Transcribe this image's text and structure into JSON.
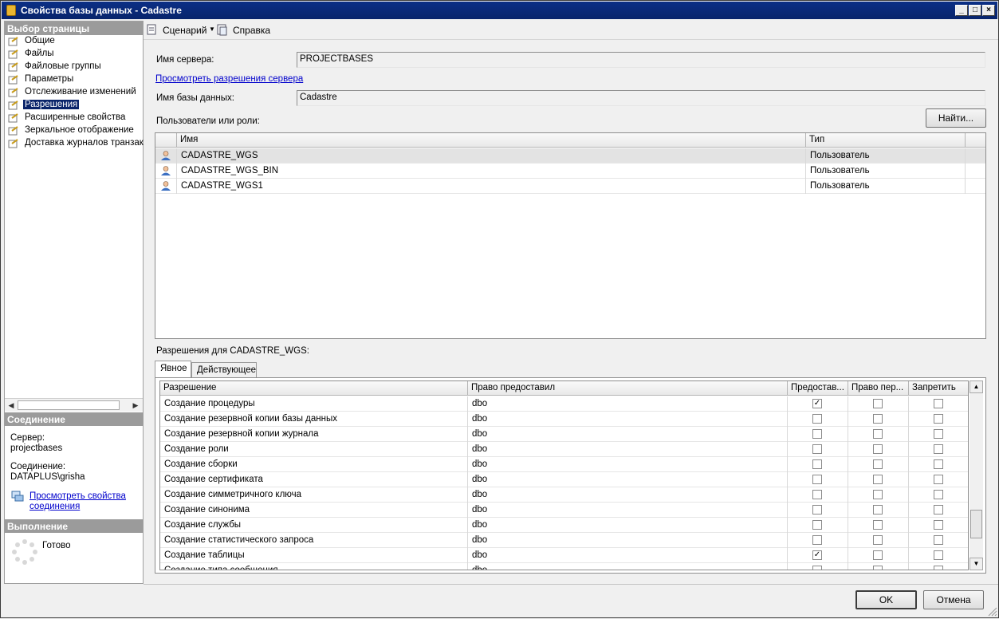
{
  "window": {
    "title": "Свойства базы данных - Cadastre"
  },
  "left_panel": {
    "select_page_header": "Выбор страницы",
    "items": [
      {
        "label": "Общие"
      },
      {
        "label": "Файлы"
      },
      {
        "label": "Файловые группы"
      },
      {
        "label": "Параметры"
      },
      {
        "label": "Отслеживание изменений"
      },
      {
        "label": "Разрешения",
        "selected": true
      },
      {
        "label": "Расширенные свойства"
      },
      {
        "label": "Зеркальное отображение"
      },
      {
        "label": "Доставка журналов транзакций"
      }
    ],
    "connection_header": "Соединение",
    "server_label": "Сервер:",
    "server_value": "projectbases",
    "connection_label": "Соединение:",
    "connection_value": "DATAPLUS\\grisha",
    "view_conn_link_1": "Просмотреть свойства",
    "view_conn_link_2": "соединения",
    "progress_header": "Выполнение",
    "progress_status": "Готово"
  },
  "toolbar": {
    "script_label": "Сценарий",
    "help_label": "Справка"
  },
  "main": {
    "server_name_label": "Имя сервера:",
    "server_name_value": "PROJECTBASES",
    "view_server_perms_link": "Просмотреть разрешения сервера",
    "db_name_label": "Имя базы данных:",
    "db_name_value": "Cadastre",
    "users_roles_label": "Пользователи или роли:",
    "find_button": "Найти...",
    "users_columns": {
      "name": "Имя",
      "type": "Тип"
    },
    "users": [
      {
        "name": "CADASTRE_WGS",
        "type": "Пользователь",
        "selected": true
      },
      {
        "name": "CADASTRE_WGS_BIN",
        "type": "Пользователь"
      },
      {
        "name": "CADASTRE_WGS1",
        "type": "Пользователь"
      }
    ],
    "perms_for_label": "Разрешения для CADASTRE_WGS:",
    "tabs": [
      {
        "label": "Явное",
        "active": true
      },
      {
        "label": "Действующее"
      }
    ],
    "perm_columns": {
      "permission": "Разрешение",
      "grantor": "Право предоставил",
      "grant": "Предостав...",
      "with_grant": "Право пер...",
      "deny": "Запретить"
    },
    "permissions": [
      {
        "name": "Создание процедуры",
        "grantor": "dbo",
        "grant": true,
        "with_grant": false,
        "deny": false
      },
      {
        "name": "Создание резервной копии базы данных",
        "grantor": "dbo",
        "grant": false,
        "with_grant": false,
        "deny": false
      },
      {
        "name": "Создание резервной копии журнала",
        "grantor": "dbo",
        "grant": false,
        "with_grant": false,
        "deny": false
      },
      {
        "name": "Создание роли",
        "grantor": "dbo",
        "grant": false,
        "with_grant": false,
        "deny": false
      },
      {
        "name": "Создание сборки",
        "grantor": "dbo",
        "grant": false,
        "with_grant": false,
        "deny": false
      },
      {
        "name": "Создание сертификата",
        "grantor": "dbo",
        "grant": false,
        "with_grant": false,
        "deny": false
      },
      {
        "name": "Создание симметричного ключа",
        "grantor": "dbo",
        "grant": false,
        "with_grant": false,
        "deny": false
      },
      {
        "name": "Создание синонима",
        "grantor": "dbo",
        "grant": false,
        "with_grant": false,
        "deny": false
      },
      {
        "name": "Создание службы",
        "grantor": "dbo",
        "grant": false,
        "with_grant": false,
        "deny": false
      },
      {
        "name": "Создание статистического запроса",
        "grantor": "dbo",
        "grant": false,
        "with_grant": false,
        "deny": false
      },
      {
        "name": "Создание таблицы",
        "grantor": "dbo",
        "grant": true,
        "with_grant": false,
        "deny": false
      },
      {
        "name": "Создание типа сообщения",
        "grantor": "dbo",
        "grant": false,
        "with_grant": false,
        "deny": false
      }
    ],
    "ok_button": "OK",
    "cancel_button": "Отмена"
  },
  "colors": {
    "selection": "#0a246a",
    "title_bar": "#0b2f86",
    "link": "#0000cc"
  }
}
